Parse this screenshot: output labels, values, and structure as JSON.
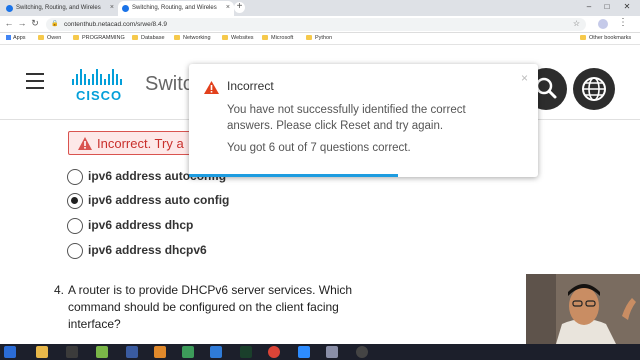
{
  "browser": {
    "tabs": [
      {
        "title": "Switching, Routing, and Wireles"
      },
      {
        "title": "Switching, Routing, and Wireles"
      }
    ],
    "url": "contenthub.netacad.com/srwe/8.4.9",
    "bookmarks": [
      "Apps",
      "Owen",
      "PROGRAMMING",
      "Database",
      "Networking",
      "Websites",
      "Microsoft",
      "Python"
    ],
    "other_bookmarks": "Other bookmarks"
  },
  "header": {
    "logo_text": "CISCO",
    "course_title": "Switc"
  },
  "quiz": {
    "result_banner": "Incorrect. Try a",
    "options": [
      {
        "label": "ipv6 address autoconfig",
        "selected": false
      },
      {
        "label": "ipv6 address auto config",
        "selected": true
      },
      {
        "label": "ipv6 address dhcp",
        "selected": false
      },
      {
        "label": "ipv6 address dhcpv6",
        "selected": false
      }
    ],
    "next_question": {
      "number": "4.",
      "text": "A router is to provide DHCPv6 server services. Which command should be configured on the client facing interface?"
    }
  },
  "modal": {
    "title": "Incorrect",
    "close": "×",
    "message": "You have not successfully identified the correct answers. Please click Reset and try again.",
    "score": "You got 6 out of 7 questions correct.",
    "progress": 0.6
  },
  "colors": {
    "accent": "#049fd9",
    "error": "#d9534f",
    "warning_icon": "#e2401c",
    "progress": "#1d9ce0"
  }
}
